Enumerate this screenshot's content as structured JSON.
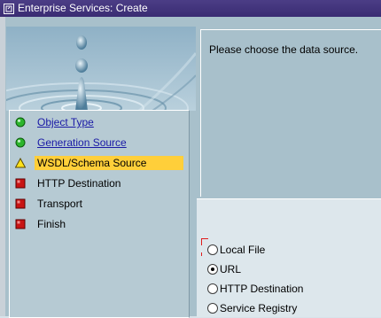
{
  "window": {
    "title": "Enterprise Services: Create"
  },
  "roadmap": {
    "steps": [
      {
        "label": "Object Type",
        "status": "done",
        "link": true
      },
      {
        "label": "Generation Source",
        "status": "done",
        "link": true
      },
      {
        "label": "WSDL/Schema Source",
        "status": "current",
        "link": false
      },
      {
        "label": "HTTP Destination",
        "status": "pending",
        "link": false
      },
      {
        "label": "Transport",
        "status": "pending",
        "link": false
      },
      {
        "label": "Finish",
        "status": "pending",
        "link": false
      }
    ]
  },
  "content": {
    "instruction": "Please choose the data source.",
    "options": [
      {
        "label": "Local File",
        "selected": false
      },
      {
        "label": "URL",
        "selected": true
      },
      {
        "label": "HTTP Destination",
        "selected": false
      },
      {
        "label": "Service Registry",
        "selected": false
      }
    ]
  },
  "colors": {
    "titlebar": "#3f3179",
    "active_step": "#ffcf3a",
    "done_icon": "#2db52d",
    "pending_icon": "#c81414",
    "current_icon": "#ffe21a"
  }
}
